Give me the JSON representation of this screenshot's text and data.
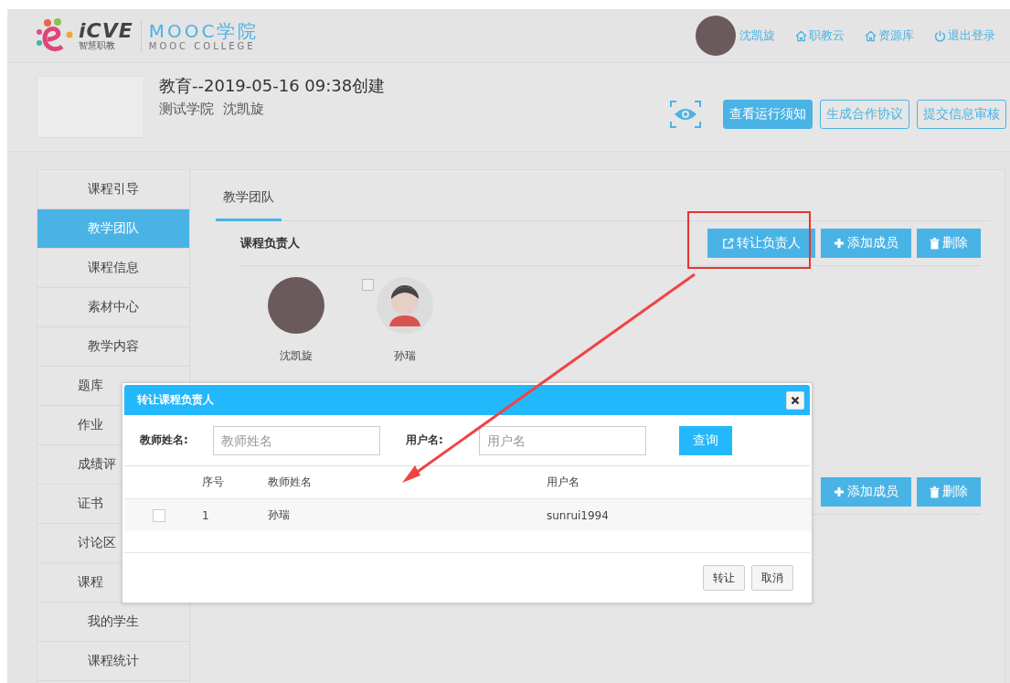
{
  "header": {
    "logo_mark": "iCVE",
    "logo_sub": "智慧职教",
    "brand_title": "MOOC学院",
    "brand_subtitle": "MOOC COLLEGE",
    "user_name": "沈凯旋",
    "nav_links": [
      {
        "label": "职教云",
        "kind": "home"
      },
      {
        "label": "资源库",
        "kind": "home"
      },
      {
        "label": "退出登录",
        "kind": "power"
      }
    ]
  },
  "course": {
    "title": "教育--2019-05-16 09:38创建",
    "subtitle": "测试学院  沈凯旋",
    "buttons": [
      {
        "label": "查看运行须知",
        "kind": "filled"
      },
      {
        "label": "生成合作协议",
        "kind": "outline"
      },
      {
        "label": "提交信息审核",
        "kind": "outline"
      }
    ]
  },
  "sidebar": {
    "items": [
      {
        "label": "课程引导",
        "selected": false
      },
      {
        "label": "教学团队",
        "selected": true
      },
      {
        "label": "课程信息",
        "selected": false
      },
      {
        "label": "素材中心",
        "selected": false
      },
      {
        "label": "教学内容",
        "selected": false
      },
      {
        "label": "题库",
        "selected": false
      },
      {
        "label": "作业",
        "selected": false
      },
      {
        "label": "成绩评",
        "selected": false
      },
      {
        "label": "证书",
        "selected": false
      },
      {
        "label": "讨论区",
        "selected": false
      },
      {
        "label": "课程",
        "selected": false
      },
      {
        "label": "我的学生",
        "selected": false
      },
      {
        "label": "课程统计",
        "selected": false
      }
    ]
  },
  "tabs": [
    {
      "label": "教学团队",
      "selected": true
    }
  ],
  "sections": [
    {
      "title": "课程负责人",
      "buttons": [
        {
          "label": "转让负责人",
          "kind": "transfer"
        },
        {
          "label": "添加成员",
          "kind": "add"
        },
        {
          "label": "删除",
          "kind": "delete"
        }
      ],
      "members": [
        {
          "name": "沈凯旋",
          "kind": "photo"
        },
        {
          "name": "孙瑞",
          "kind": "default",
          "checked": false
        }
      ]
    },
    {
      "buttons": [
        {
          "label": "添加成员",
          "kind": "add"
        },
        {
          "label": "删除",
          "kind": "delete"
        }
      ]
    }
  ],
  "dialog": {
    "title": "转让课程负责人",
    "fields": [
      {
        "label": "教师姓名:",
        "placeholder": "教师姓名"
      },
      {
        "label": "用户名:",
        "placeholder": "用户名"
      }
    ],
    "search_button": "查询",
    "table": {
      "columns": [
        "序号",
        "教师姓名",
        "用户名"
      ],
      "rows": [
        {
          "checked": false,
          "cells": [
            "1",
            "孙瑞",
            "sunrui1994"
          ]
        }
      ]
    },
    "buttons": [
      "转让",
      "取消"
    ]
  }
}
